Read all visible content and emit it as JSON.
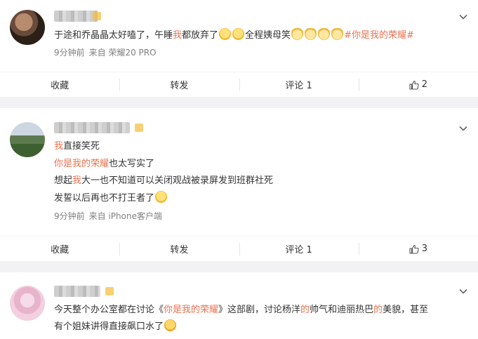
{
  "posts": [
    {
      "lines": [
        [
          {
            "t": "于途和乔晶晶太好嗑了，午睡"
          },
          {
            "t": "我",
            "hl": true
          },
          {
            "t": "都放弃了"
          },
          {
            "emoji": "laugh-cry"
          },
          {
            "emoji": "laugh-cry"
          },
          {
            "t": "全程姨母笑"
          },
          {
            "emoji": "cat-face"
          },
          {
            "emoji": "cat-face"
          },
          {
            "emoji": "cat-face"
          },
          {
            "emoji": "cat-face"
          },
          {
            "t": "#你是我的荣耀#",
            "hl": true
          }
        ]
      ],
      "time": "9分钟前",
      "source": "来自 荣耀20 PRO",
      "actions": {
        "favorite": "收藏",
        "repost": "转发",
        "comment": "评论 1",
        "like": "2"
      }
    },
    {
      "lines": [
        [
          {
            "t": "我",
            "hl": true
          },
          {
            "t": "直接笑死"
          }
        ],
        [
          {
            "t": "你是我的荣耀",
            "hl": true
          },
          {
            "t": "也太写实了"
          }
        ],
        [
          {
            "t": "想起"
          },
          {
            "t": "我",
            "hl": true
          },
          {
            "t": "大一也不知道可以关闭观战被录屏发到班群社死"
          }
        ],
        [
          {
            "t": "发誓以后再也不打王者了"
          },
          {
            "emoji": "smile"
          }
        ]
      ],
      "time": "9分钟前",
      "source": "来自 iPhone客户端",
      "actions": {
        "favorite": "收藏",
        "repost": "转发",
        "comment": "评论 1",
        "like": "3"
      }
    },
    {
      "lines": [
        [
          {
            "t": "今天整个办公室都在讨论《"
          },
          {
            "t": "你是我的荣耀",
            "hl": true
          },
          {
            "t": "》这部剧，讨论杨洋"
          },
          {
            "t": "的",
            "hl": true
          },
          {
            "t": "帅气和迪丽热巴"
          },
          {
            "t": "的",
            "hl": true
          },
          {
            "t": "美貌，甚至"
          }
        ],
        [
          {
            "t": "有个姐妹讲得直接飙口水了"
          },
          {
            "emoji": "drool"
          }
        ]
      ]
    }
  ],
  "colors": {
    "highlight": "#eb7350",
    "meta": "#808080",
    "text": "#333333"
  },
  "icons": {
    "more": "chevron-down-icon",
    "like": "thumbs-up-icon"
  }
}
